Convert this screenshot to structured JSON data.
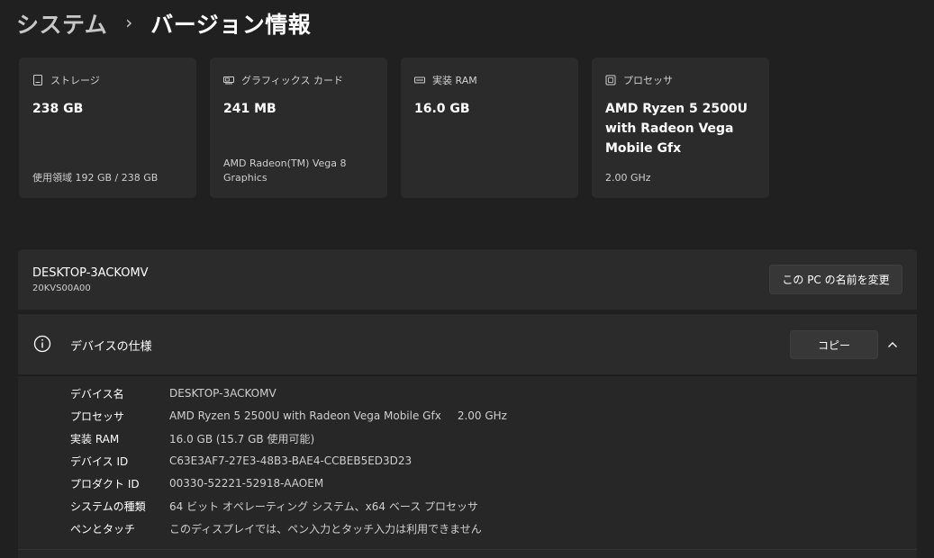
{
  "breadcrumb": {
    "parent": "システム",
    "separator": "›",
    "current": "バージョン情報"
  },
  "cards": [
    {
      "icon": "storage-icon",
      "label": "ストレージ",
      "value": "238 GB",
      "sub": "使用領域 192 GB / 238 GB"
    },
    {
      "icon": "graphics-card-icon",
      "label": "グラフィックス カード",
      "value": "241 MB",
      "sub": "AMD Radeon(TM) Vega 8 Graphics"
    },
    {
      "icon": "memory-icon",
      "label": "実装 RAM",
      "value": "16.0 GB",
      "sub": ""
    },
    {
      "icon": "processor-icon",
      "label": "プロセッサ",
      "value": "AMD Ryzen 5 2500U with Radeon Vega Mobile Gfx",
      "sub": "2.00 GHz"
    }
  ],
  "device": {
    "name": "DESKTOP-3ACKOMV",
    "model": "20KVS00A00",
    "rename_label": "この PC の名前を変更"
  },
  "spec": {
    "title": "デバイスの仕様",
    "copy_label": "コピー",
    "rows": [
      {
        "key": "デバイス名",
        "value": "DESKTOP-3ACKOMV",
        "extra": ""
      },
      {
        "key": "プロセッサ",
        "value": "AMD Ryzen 5 2500U with Radeon Vega Mobile Gfx",
        "extra": "2.00 GHz"
      },
      {
        "key": "実装 RAM",
        "value": "16.0 GB (15.7 GB 使用可能)",
        "extra": ""
      },
      {
        "key": "デバイス ID",
        "value": "C63E3AF7-27E3-48B3-BAE4-CCBEB5ED3D23",
        "extra": ""
      },
      {
        "key": "プロダクト ID",
        "value": "00330-52221-52918-AAOEM",
        "extra": ""
      },
      {
        "key": "システムの種類",
        "value": "64 ビット オペレーティング システム、x64 ベース プロセッサ",
        "extra": ""
      },
      {
        "key": "ペンとタッチ",
        "value": "このディスプレイでは、ペン入力とタッチ入力は利用できません",
        "extra": ""
      }
    ]
  },
  "colors": {
    "background": "#202020",
    "card": "#2b2b2b",
    "button": "#373737"
  }
}
